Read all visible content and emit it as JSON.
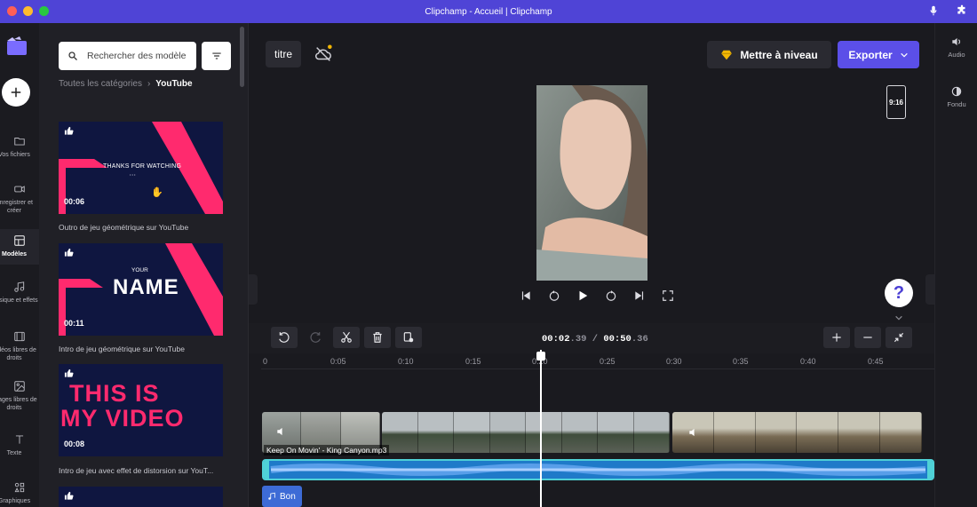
{
  "window": {
    "title": "Clipchamp - Accueil | Clipchamp"
  },
  "rail": {
    "items": [
      {
        "label": "Vos fichiers",
        "icon": "folder-icon"
      },
      {
        "label": "Enregistrer et créer",
        "icon": "camera-icon"
      },
      {
        "label": "Modèles",
        "icon": "templates-icon",
        "active": true
      },
      {
        "label": "Musique et effets",
        "icon": "music-icon"
      },
      {
        "label": "Vidéos libres de droits",
        "icon": "film-icon"
      },
      {
        "label": "Images libres de droits",
        "icon": "image-icon"
      },
      {
        "label": "Texte",
        "icon": "text-icon"
      },
      {
        "label": "Graphiques",
        "icon": "graphics-icon"
      }
    ]
  },
  "panel": {
    "search_placeholder": "Rechercher des modèle",
    "breadcrumb": {
      "root": "Toutes les catégories",
      "current": "YouTube"
    },
    "templates": [
      {
        "duration": "00:06",
        "label": "Outro de jeu géométrique sur YouTube",
        "text": "THANKS FOR WATCHING"
      },
      {
        "duration": "00:11",
        "label": "Intro de jeu géométrique sur YouTube",
        "small": "YOUR",
        "big": "NAME"
      },
      {
        "duration": "00:08",
        "label": "Intro de jeu avec effet de distorsion sur YouT...",
        "line1": "THIS IS",
        "line2": "MY VIDEO"
      }
    ]
  },
  "editor": {
    "project_title": "titre",
    "upgrade_label": "Mettre à niveau",
    "export_label": "Exporter",
    "aspect_ratio": "9:16",
    "help_label": "?",
    "timecode": {
      "current": "00:02",
      "current_frac": ".39",
      "sep": " / ",
      "total": "00:50",
      "total_frac": ".36"
    },
    "ruler": [
      "0",
      "0:05",
      "0:10",
      "0:15",
      "0:20",
      "0:25",
      "0:30",
      "0:35",
      "0:40",
      "0:45"
    ],
    "audio_clip_label": "Keep On Movin' - King Canyon.mp3",
    "music_chip_label": "Bon"
  },
  "right_rail": {
    "items": [
      {
        "label": "Audio",
        "icon": "speaker-icon"
      },
      {
        "label": "Fondu",
        "icon": "fade-icon"
      }
    ]
  },
  "colors": {
    "titlebar": "#4f44d6",
    "accent": "#5b4fe8",
    "template_pink": "#ff2a6e",
    "template_navy": "#0f1640",
    "audio_track": "#1f7ac9",
    "selection": "#4fd1d6"
  }
}
